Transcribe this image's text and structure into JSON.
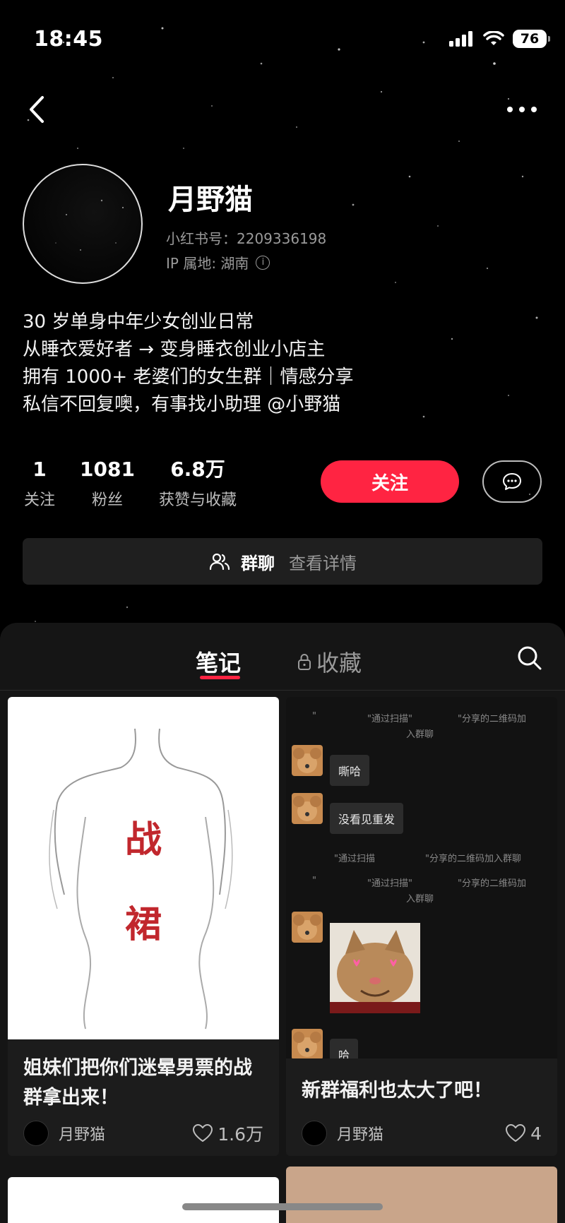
{
  "status_bar": {
    "time": "18:45",
    "battery": "76"
  },
  "profile": {
    "name": "月野猫",
    "red_id": "小红书号：2209336198",
    "ip_location": "IP 属地: 湖南",
    "bio": [
      "30 岁单身中年少女创业日常",
      "从睡衣爱好者 → 变身睡衣创业小店主",
      "拥有 1000+ 老婆们的女生群｜情感分享",
      "私信不回复噢，有事找小助理 @小野猫"
    ],
    "stats": [
      {
        "value": "1",
        "label": "关注"
      },
      {
        "value": "1081",
        "label": "粉丝"
      },
      {
        "value": "6.8万",
        "label": "获赞与收藏"
      }
    ],
    "follow_label": "关注"
  },
  "group_bar": {
    "title": "群聊",
    "detail": "查看详情"
  },
  "tabs": {
    "notes": "笔记",
    "collections": "收藏"
  },
  "notes": [
    {
      "cover_words": [
        "战",
        "裙"
      ],
      "title": "姐妹们把你们迷晕男票的战群拿出来！",
      "author": "月野猫",
      "likes": "1.6万"
    },
    {
      "title": "新群福利也太大了吧！",
      "author": "月野猫",
      "likes": "4",
      "chat": {
        "sys1": [
          "\"",
          "\"通过扫描\"",
          "\"分享的二维码加",
          "入群聊"
        ],
        "msg1": "嘶哈",
        "msg2": "没看见重发",
        "sys2": [
          "\"通过扫描",
          "\"分享的二维码加入群聊"
        ],
        "sys3": [
          "\"",
          "\"通过扫描\"",
          "\"分享的二维码加",
          "入群聊"
        ],
        "msg3": "哈"
      }
    }
  ]
}
